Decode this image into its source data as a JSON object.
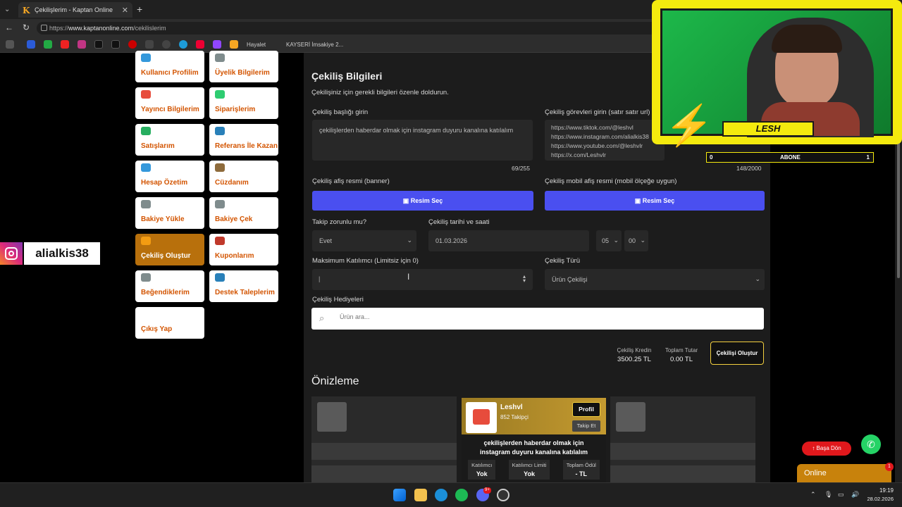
{
  "browser": {
    "tab_title": "Çekilişlerim - Kaptan Online",
    "tab_favicon": "K",
    "new_tab": "+",
    "url_prefix": "https://",
    "url_domain": "www.kaptanonline.com",
    "url_path": "/cekilislerim",
    "bookmarks": [
      "Hayalet",
      "KAYSERİ İmsakiye 2..."
    ]
  },
  "sidebar": {
    "items": [
      {
        "label": "Kullanıcı Profilim"
      },
      {
        "label": "Üyelik Bilgilerim"
      },
      {
        "label": "Yayıncı Bilgilerim"
      },
      {
        "label": "Siparişlerim"
      },
      {
        "label": "Satışlarım"
      },
      {
        "label": "Referans İle Kazan"
      },
      {
        "label": "Hesap Özetim"
      },
      {
        "label": "Cüzdanım"
      },
      {
        "label": "Bakiye Yükle"
      },
      {
        "label": "Bakiye Çek"
      },
      {
        "label": "Çekiliş Oluştur"
      },
      {
        "label": "Kuponlarım"
      },
      {
        "label": "Beğendiklerim"
      },
      {
        "label": "Destek Taleplerim"
      },
      {
        "label": "Çıkış Yap"
      }
    ]
  },
  "overlay_instagram": {
    "username": "alialkis38"
  },
  "form": {
    "title": "Çekiliş Bilgileri",
    "subtitle": "Çekilişiniz için gerekli bilgileri özenle doldurun.",
    "title_label": "Çekiliş başlığı girin",
    "title_value": "çekilişlerden haberdar olmak için instagram duyuru kanalına katılalım",
    "title_count": "69/255",
    "tasks_label": "Çekiliş görevleri girin (satır satır url)",
    "tasks_lines": [
      "https://www.tiktok.com/@leshvl",
      "https://www.instagram.com/alialkis38",
      "https://www.youtube.com/@leshvlr",
      "https://x.com/Leshvlr"
    ],
    "tasks_count": "148/2000",
    "banner_label": "Çekiliş afiş resmi (banner)",
    "mobile_banner_label": "Çekiliş mobil afiş resmi (mobil ölçeğe uygun)",
    "choose_image": "Resim Seç",
    "follow_label": "Takip zorunlu mu?",
    "follow_value": "Evet",
    "date_label": "Çekiliş tarihi ve saati",
    "date_value": "01.03.2026",
    "hour_value": "05",
    "minute_value": "00",
    "max_label": "Maksimum Katılımcı (Limitsiz için 0)",
    "max_value": "",
    "type_label": "Çekiliş Türü",
    "type_value": "Ürün Çekilişi",
    "gifts_label": "Çekiliş Hediyeleri",
    "search_placeholder": "Ürün ara...",
    "credit_label": "Çekiliş Kredin",
    "credit_value": "3500.25 TL",
    "total_label": "Toplam Tutar",
    "total_value": "0.00 TL",
    "create_button": "Çekilişi Oluştur",
    "preview_title": "Önizleme"
  },
  "preview_card": {
    "name": "Leshvl",
    "followers": "852 Takipçi",
    "profile_button": "Profil",
    "follow_button": "Takip Et",
    "title": "çekilişlerden haberdar olmak için instagram duyuru kanalına katılalım",
    "stats": [
      {
        "label": "Katılımcı",
        "value": "Yok"
      },
      {
        "label": "Katılımcı Limiti",
        "value": "Yok"
      },
      {
        "label": "Toplam Ödül",
        "value": "- TL"
      }
    ]
  },
  "webcam": {
    "name": "LESH",
    "abone_label": "ABONE",
    "abone_left": "0",
    "abone_right": "1"
  },
  "floating": {
    "back_to_top": "Başa Dön",
    "online": "Online",
    "online_badge": "1"
  },
  "taskbar": {
    "time": "19:19",
    "date": "28.02.2026",
    "discord_badge": "9+"
  }
}
